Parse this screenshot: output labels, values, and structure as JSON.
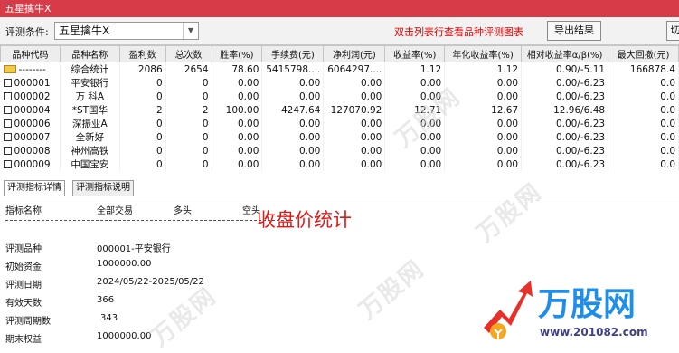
{
  "window": {
    "title": "五星擒牛X"
  },
  "toolbar": {
    "label": "评测条件:",
    "selected": "五星擒牛X",
    "hint": "双击列表行查看品种评测图表",
    "export_label": "导出结果",
    "extra_button_label": "切"
  },
  "table": {
    "columns": [
      "品种代码",
      "品种名称",
      "盈利数",
      "总次数",
      "胜率(%)",
      "手续费(元)",
      "净利润(元)",
      "收益率(%)",
      "年化收益率(%)",
      "相对收益率α/β(%)",
      "最大回撤(元)"
    ],
    "rows": [
      [
        "--------",
        "综合统计",
        "2086",
        "2654",
        "78.60",
        "5415798....",
        "6064297....",
        "1.12",
        "1.12",
        "0.90/-5.11",
        "166878.4"
      ],
      [
        "000001",
        "平安银行",
        "0",
        "0",
        "0.00",
        "0.00",
        "0.00",
        "0.00",
        "0.00",
        "0.00/-6.23",
        "0.0"
      ],
      [
        "000002",
        "万 科A",
        "0",
        "0",
        "0.00",
        "0.00",
        "0.00",
        "0.00",
        "0.00",
        "0.00/-6.23",
        "0.0"
      ],
      [
        "000004",
        "*ST国华",
        "2",
        "2",
        "100.00",
        "4247.64",
        "127070.92",
        "12.71",
        "12.67",
        "12.96/6.48",
        "0.0"
      ],
      [
        "000006",
        "深振业A",
        "0",
        "0",
        "0.00",
        "0.00",
        "0.00",
        "0.00",
        "0.00",
        "0.00/-6.23",
        "0.0"
      ],
      [
        "000007",
        "全新好",
        "0",
        "0",
        "0.00",
        "0.00",
        "0.00",
        "0.00",
        "0.00",
        "0.00/-6.23",
        "0.0"
      ],
      [
        "000008",
        "神州高铁",
        "0",
        "0",
        "0.00",
        "0.00",
        "0.00",
        "0.00",
        "0.00",
        "0.00/-6.23",
        "0.0"
      ],
      [
        "000009",
        "中国宝安",
        "0",
        "0",
        "0.00",
        "0.00",
        "0.00",
        "0.00",
        "0.00",
        "0.00/-6.23",
        "0.0"
      ]
    ]
  },
  "tabs": [
    "评测指标详情",
    "评测指标说明"
  ],
  "detail": {
    "header": [
      "指标名称",
      "全部交易",
      "多头",
      "空头"
    ],
    "rows": [
      {
        "label": "评测品种",
        "value": "000001-平安银行"
      },
      {
        "label": "初始资金",
        "value": "1000000.00"
      },
      {
        "label": "评测日期",
        "value": "2024/05/22-2025/05/22"
      },
      {
        "label": "有效天数",
        "value": "366"
      },
      {
        "label": "评测周期数",
        "value": "343"
      },
      {
        "label": "期末权益",
        "value": "1000000.00"
      }
    ],
    "annotation": "收盘价统计"
  },
  "watermark": {
    "logo_text": "万股网",
    "url": "www.201082.com"
  },
  "colors": {
    "titlebar": "#d63b47",
    "hint": "#e00000",
    "annotation": "#e01818",
    "logo": "#1e8ee8"
  }
}
